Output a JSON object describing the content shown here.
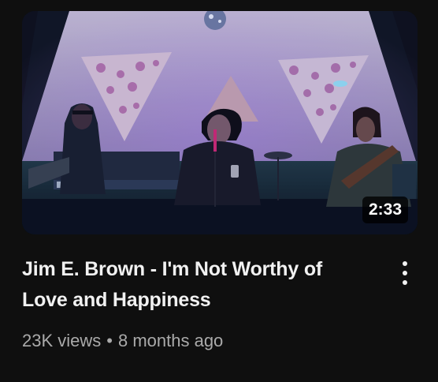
{
  "video": {
    "duration": "2:33",
    "title": "Jim E. Brown - I'm Not Worthy of Love and Happiness",
    "views": "23K views",
    "separator": "•",
    "age": "8 months ago"
  },
  "icons": {
    "menu": "more-vertical-icon"
  },
  "colors": {
    "background": "#0f0f0f",
    "title": "#f1f1f1",
    "meta": "#aaaaaa",
    "duration_badge_bg": "#000000"
  }
}
